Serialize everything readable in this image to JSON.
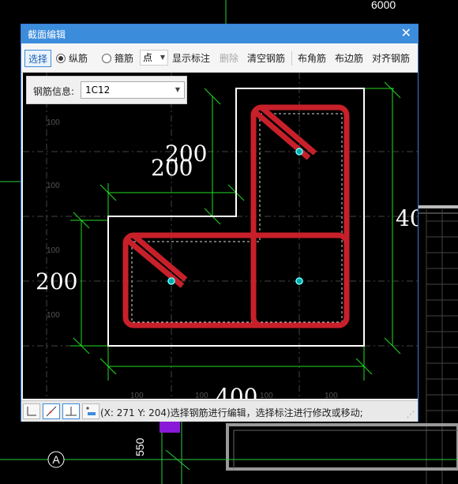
{
  "background": {
    "top_dimension": "6000",
    "axis_label": "A",
    "side_dimension": "550"
  },
  "dialog": {
    "title": "截面编辑",
    "close_icon": "close-icon"
  },
  "toolbar": {
    "select_label": "选择",
    "longitudinal_label": "纵筋",
    "stirrup_label": "箍筋",
    "point_label": "点",
    "show_dims_label": "显示标注",
    "delete_label": "删除",
    "clear_rebar_label": "清空钢筋",
    "corner_rebar_label": "布角筋",
    "side_rebar_label": "布边筋",
    "align_rebar_label": "对齐钢筋"
  },
  "rebar_info": {
    "label": "钢筋信息:",
    "value": "1C12"
  },
  "drawing": {
    "dim_top": "200",
    "dim_top_dup": "200",
    "dim_left": "200",
    "dim_bottom": "400",
    "dim_right": "40",
    "grid_label": "100"
  },
  "status": {
    "text": "(X: 271 Y: 204)选择钢筋进行编辑，选择标注进行修改或移动;"
  },
  "colors": {
    "rebar": "#c8202a",
    "dimension": "#22dd22",
    "outline": "#ffffff",
    "accent": "#3c8cdc"
  }
}
